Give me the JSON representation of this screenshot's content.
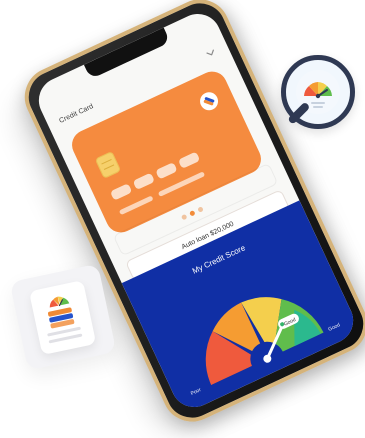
{
  "phone": {
    "header_title": "Credit Card",
    "loan_text": "Auto loan $20,000",
    "score_title": "My Credit Score",
    "poor_label": "Poor",
    "good_label": "Good",
    "good_badge": "Good"
  },
  "icons": {
    "chevron": "chevron-down-icon",
    "magnifier": "magnifier-gauge-icon",
    "report": "credit-report-icon"
  },
  "colors": {
    "orange": "#f58b3f",
    "blue": "#102fa5",
    "gold": "#d5b37a"
  }
}
